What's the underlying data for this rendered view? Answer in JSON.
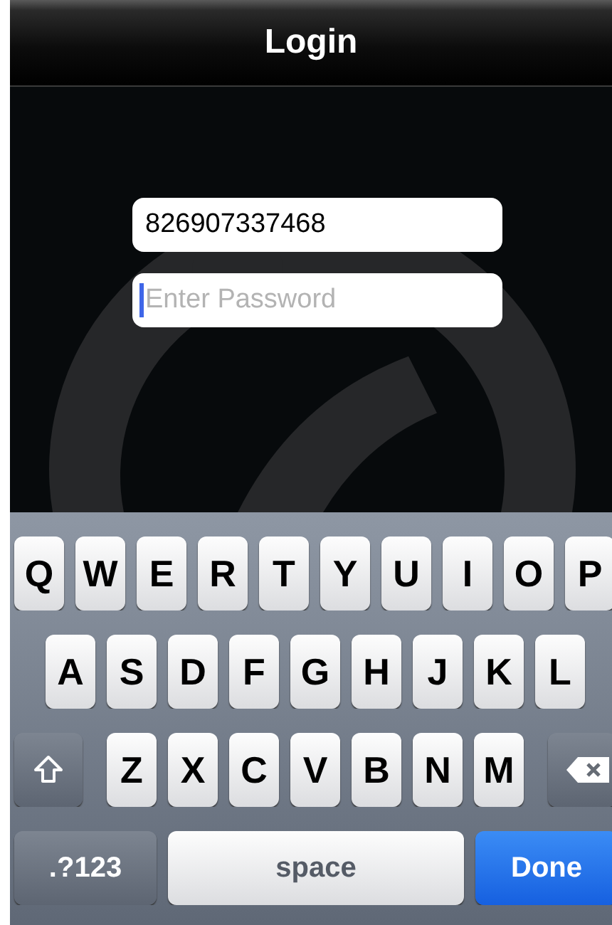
{
  "nav_bar": {
    "title": "Login"
  },
  "fields": [
    {
      "kind": "text",
      "value": "826907337468",
      "focused": false
    },
    {
      "kind": "password",
      "placeholder": "Enter Password",
      "focused": true
    }
  ],
  "keyboard": {
    "letter_rows": [
      {
        "keys": [
          {
            "kind": "letter",
            "label": "Q"
          },
          {
            "kind": "letter",
            "label": "W"
          },
          {
            "kind": "letter",
            "label": "E"
          },
          {
            "kind": "letter",
            "label": "R"
          },
          {
            "kind": "letter",
            "label": "T"
          },
          {
            "kind": "letter",
            "label": "Y"
          },
          {
            "kind": "letter",
            "label": "U"
          },
          {
            "kind": "letter",
            "label": "I"
          },
          {
            "kind": "letter",
            "label": "O"
          },
          {
            "kind": "letter",
            "label": "P"
          }
        ]
      },
      {
        "keys": [
          {
            "kind": "letter",
            "label": "A"
          },
          {
            "kind": "letter",
            "label": "S"
          },
          {
            "kind": "letter",
            "label": "D"
          },
          {
            "kind": "letter",
            "label": "F"
          },
          {
            "kind": "letter",
            "label": "G"
          },
          {
            "kind": "letter",
            "label": "H"
          },
          {
            "kind": "letter",
            "label": "J"
          },
          {
            "kind": "letter",
            "label": "K"
          },
          {
            "kind": "letter",
            "label": "L"
          }
        ]
      },
      {
        "keys": [
          {
            "kind": "shift"
          },
          {
            "kind": "letter",
            "label": "Z"
          },
          {
            "kind": "letter",
            "label": "X"
          },
          {
            "kind": "letter",
            "label": "C"
          },
          {
            "kind": "letter",
            "label": "V"
          },
          {
            "kind": "letter",
            "label": "B"
          },
          {
            "kind": "letter",
            "label": "N"
          },
          {
            "kind": "letter",
            "label": "M"
          },
          {
            "kind": "backspace"
          }
        ]
      }
    ],
    "bottom_bar": {
      "mode_key": ".?123",
      "space_bar": "space",
      "done_button": "Done"
    }
  }
}
